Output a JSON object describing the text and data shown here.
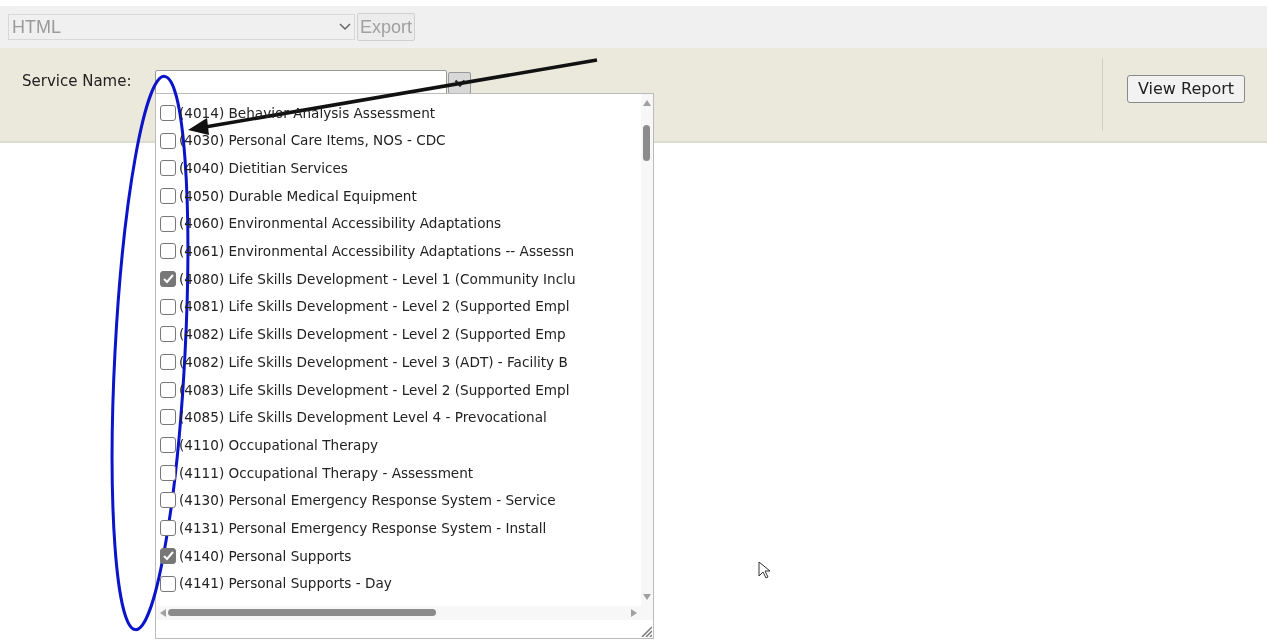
{
  "toolbar": {
    "format_select": {
      "value": "HTML",
      "disabled": true
    },
    "export_button": {
      "label": "Export",
      "disabled": true
    }
  },
  "filter_panel": {
    "service_name": {
      "label": "Service Name:"
    },
    "view_report_button": {
      "label": "View Report"
    }
  },
  "service_list": [
    {
      "label": "(4014) Behavior Analysis Assessment",
      "checked": false
    },
    {
      "label": "(4030) Personal Care Items, NOS - CDC",
      "checked": false
    },
    {
      "label": "(4040) Dietitian Services",
      "checked": false
    },
    {
      "label": "(4050) Durable Medical Equipment",
      "checked": false
    },
    {
      "label": "(4060) Environmental Accessibility Adaptations",
      "checked": false
    },
    {
      "label": "(4061) Environmental Accessibility Adaptations -- Assessn",
      "checked": false
    },
    {
      "label": "(4080) Life Skills Development - Level 1 (Community Inclu",
      "checked": true
    },
    {
      "label": "(4081) Life Skills Development - Level 2 (Supported Empl",
      "checked": false
    },
    {
      "label": "(4082) Life Skills Development - Level 2  (Supported Emp",
      "checked": false
    },
    {
      "label": "(4082) Life Skills Development - Level 3 (ADT) - Facility B",
      "checked": false
    },
    {
      "label": "(4083) Life Skills Development - Level 2 (Supported Empl",
      "checked": false
    },
    {
      "label": "(4085) Life Skills Development Level 4 - Prevocational",
      "checked": false
    },
    {
      "label": "(4110) Occupational Therapy",
      "checked": false
    },
    {
      "label": "(4111) Occupational Therapy - Assessment",
      "checked": false
    },
    {
      "label": "(4130) Personal Emergency Response System - Service",
      "checked": false
    },
    {
      "label": "(4131) Personal Emergency Response System - Install",
      "checked": false
    },
    {
      "label": "(4140) Personal Supports",
      "checked": true
    },
    {
      "label": "(4141) Personal Supports - Day",
      "checked": false
    }
  ]
}
